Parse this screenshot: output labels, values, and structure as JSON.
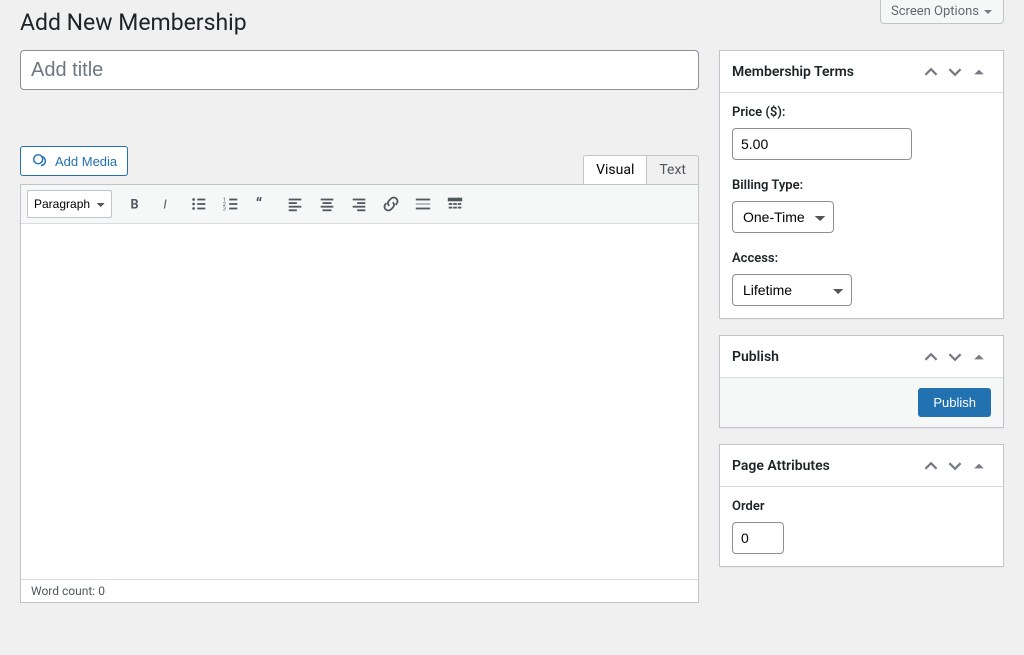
{
  "screen_options_label": "Screen Options",
  "page_title": "Add New Membership",
  "title_placeholder": "Add title",
  "add_media_label": "Add Media",
  "editor_tabs": {
    "visual": "Visual",
    "text": "Text"
  },
  "format_select": "Paragraph",
  "word_count_prefix": "Word count: ",
  "word_count": "0",
  "boxes": {
    "membership_terms": {
      "title": "Membership Terms",
      "price_label": "Price ($):",
      "price_value": "5.00",
      "billing_label": "Billing Type:",
      "billing_value": "One-Time",
      "access_label": "Access:",
      "access_value": "Lifetime"
    },
    "publish": {
      "title": "Publish",
      "button": "Publish"
    },
    "page_attributes": {
      "title": "Page Attributes",
      "order_label": "Order",
      "order_value": "0"
    }
  }
}
